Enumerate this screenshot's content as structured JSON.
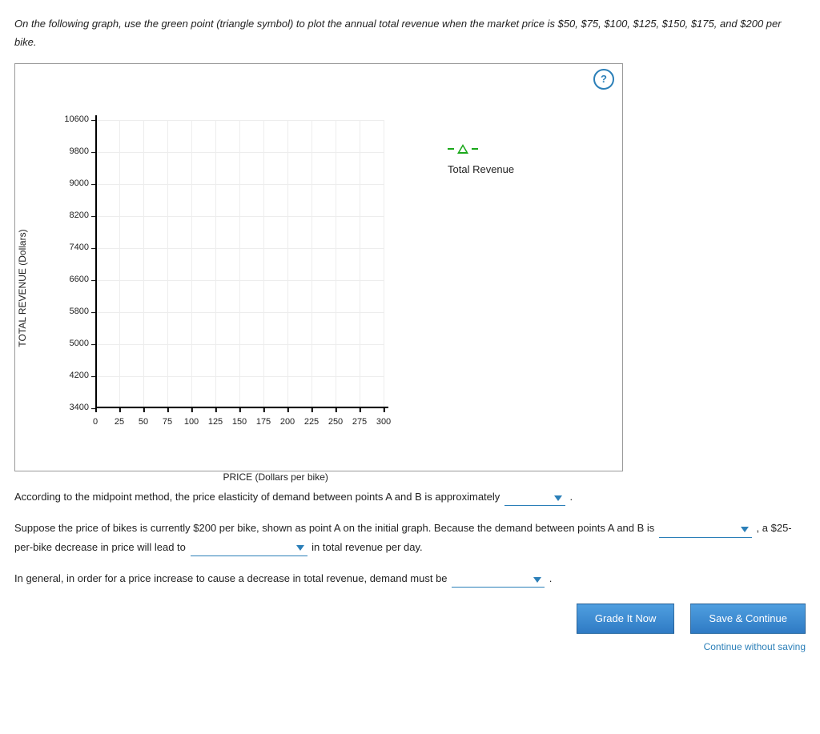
{
  "instructions": "On the following graph, use the green point (triangle symbol) to plot the annual total revenue when the market price is $50, $75, $100, $125, $150, $175, and $200 per bike.",
  "help_symbol": "?",
  "legend_label": "Total Revenue",
  "chart_data": {
    "type": "scatter",
    "title": "",
    "xlabel": "PRICE (Dollars per bike)",
    "ylabel": "TOTAL REVENUE (Dollars)",
    "xlim": [
      0,
      300
    ],
    "ylim": [
      3400,
      10600
    ],
    "x_ticks": [
      0,
      25,
      50,
      75,
      100,
      125,
      150,
      175,
      200,
      225,
      250,
      275,
      300
    ],
    "y_ticks": [
      3400,
      4200,
      5000,
      5800,
      6600,
      7400,
      8200,
      9000,
      9800,
      10600
    ],
    "series": [
      {
        "name": "Total Revenue",
        "symbol": "triangle",
        "color": "#1aa81a",
        "values": []
      }
    ]
  },
  "q1_prefix": "According to the midpoint method, the price elasticity of demand between points A and B is approximately",
  "q1_suffix": ".",
  "q2_part1": "Suppose the price of bikes is currently $200 per bike, shown as point A on the initial graph. Because the demand between points A and B is",
  "q2_part2": ", a $25-per-bike decrease in price will lead to",
  "q2_part3": "in total revenue per day.",
  "q3_prefix": "In general, in order for a price increase to cause a decrease in total revenue, demand must be",
  "q3_suffix": ".",
  "buttons": {
    "grade": "Grade It Now",
    "save": "Save & Continue",
    "continue_link": "Continue without saving"
  }
}
